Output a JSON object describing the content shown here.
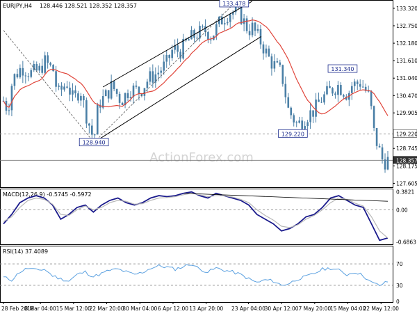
{
  "header": {
    "symbol": "EURJPY,H4",
    "ohlc": "128.446 128.521 128.352 128.357",
    "macd_title": "MACD(12,26,9) -0.5745 -0.5972",
    "rsi_title": "RSI(14) 37.4089"
  },
  "watermark": "ActionForex.com",
  "colors": {
    "candle": "#4a7fa6",
    "sma": "#e0453a",
    "macd_line": "#1a1a8c",
    "macd_signal": "#b8b8b8",
    "rsi": "#5aa0e0",
    "trendline": "#000000",
    "watermark": "#d4d4d4",
    "grid_dash": "#999999"
  },
  "chart_data": [
    {
      "type": "candlestick",
      "panel": "price",
      "ylim": [
        127.5,
        133.5
      ],
      "y_ticks": [
        "133.320",
        "132.750",
        "132.180",
        "131.610",
        "131.040",
        "130.470",
        "129.905",
        "129.220",
        "128.745",
        "128.357",
        "128.175",
        "127.605"
      ],
      "x_ticks": [
        "28 Feb 2018",
        "8 Mar 04:00",
        "15 Mar 12:00",
        "22 Mar 20:00",
        "30 Mar 04:00",
        "6 Apr 12:00",
        "13 Apr 20:00",
        "23 Apr 04:00",
        "30 Apr 12:00",
        "7 May 20:00",
        "15 May 04:00",
        "22 May 12:00"
      ],
      "labels": [
        {
          "text": "133.478",
          "x": "20 Apr",
          "y": 133.478
        },
        {
          "text": "128.940",
          "x": "20 Mar",
          "y": 128.94
        },
        {
          "text": "131.340",
          "x": "14 May",
          "y": 131.34
        },
        {
          "text": "129.220",
          "x": "3 May",
          "y": 129.22
        }
      ],
      "last_price": "128.357",
      "ref_level": "129.220",
      "overlay": "SMA",
      "close_path": [
        {
          "x": "28 Feb 2018",
          "y": 130.3
        },
        {
          "x": "1 Mar",
          "y": 130.0
        },
        {
          "x": "2 Mar",
          "y": 131.0
        },
        {
          "x": "4 Mar",
          "y": 131.4
        },
        {
          "x": "6 Mar",
          "y": 131.2
        },
        {
          "x": "8 Mar 04:00",
          "y": 131.3
        },
        {
          "x": "9 Mar",
          "y": 131.6
        },
        {
          "x": "11 Mar",
          "y": 131.3
        },
        {
          "x": "12 Mar",
          "y": 130.5
        },
        {
          "x": "14 Mar",
          "y": 130.9
        },
        {
          "x": "15 Mar 12:00",
          "y": 130.3
        },
        {
          "x": "17 Mar",
          "y": 130.7
        },
        {
          "x": "18 Mar",
          "y": 130.0
        },
        {
          "x": "20 Mar",
          "y": 129.0
        },
        {
          "x": "21 Mar",
          "y": 130.2
        },
        {
          "x": "22 Mar 20:00",
          "y": 130.5
        },
        {
          "x": "24 Mar",
          "y": 130.8
        },
        {
          "x": "26 Mar",
          "y": 130.3
        },
        {
          "x": "28 Mar",
          "y": 130.7
        },
        {
          "x": "30 Mar 04:00",
          "y": 130.6
        },
        {
          "x": "1 Apr",
          "y": 131.0
        },
        {
          "x": "3 Apr",
          "y": 131.2
        },
        {
          "x": "5 Apr",
          "y": 131.5
        },
        {
          "x": "6 Apr 12:00",
          "y": 132.0
        },
        {
          "x": "8 Apr",
          "y": 131.9
        },
        {
          "x": "10 Apr",
          "y": 132.3
        },
        {
          "x": "12 Apr",
          "y": 132.5
        },
        {
          "x": "13 Apr 20:00",
          "y": 132.6
        },
        {
          "x": "15 Apr",
          "y": 132.4
        },
        {
          "x": "17 Apr",
          "y": 132.9
        },
        {
          "x": "19 Apr",
          "y": 133.2
        },
        {
          "x": "21 Apr",
          "y": 133.2
        },
        {
          "x": "23 Apr 04:00",
          "y": 132.6
        },
        {
          "x": "24 Apr",
          "y": 132.7
        },
        {
          "x": "26 Apr",
          "y": 132.2
        },
        {
          "x": "28 Apr",
          "y": 131.6
        },
        {
          "x": "30 Apr 12:00",
          "y": 131.2
        },
        {
          "x": "2 May",
          "y": 130.0
        },
        {
          "x": "4 May",
          "y": 129.5
        },
        {
          "x": "6 May",
          "y": 129.8
        },
        {
          "x": "7 May 20:00",
          "y": 130.0
        },
        {
          "x": "9 May",
          "y": 130.3
        },
        {
          "x": "11 May",
          "y": 130.6
        },
        {
          "x": "13 May",
          "y": 130.8
        },
        {
          "x": "15 May 04:00",
          "y": 130.5
        },
        {
          "x": "16 May",
          "y": 130.8
        },
        {
          "x": "18 May",
          "y": 130.9
        },
        {
          "x": "20 May",
          "y": 130.4
        },
        {
          "x": "21 May",
          "y": 129.2
        },
        {
          "x": "22 May 12:00",
          "y": 128.5
        },
        {
          "x": "23 May",
          "y": 128.3
        },
        {
          "x": "24 May",
          "y": 128.357
        }
      ]
    },
    {
      "type": "line",
      "panel": "macd",
      "ylim": [
        -0.72,
        0.42
      ],
      "y_ticks": [
        "0.3821",
        "0.00",
        "-0.6863"
      ],
      "zero_line": true,
      "series": [
        {
          "name": "MACD",
          "values": [
            -0.3,
            -0.1,
            0.15,
            0.25,
            0.3,
            0.25,
            0.1,
            -0.2,
            -0.1,
            0.05,
            0.1,
            -0.05,
            0.1,
            0.2,
            0.25,
            0.15,
            0.1,
            0.15,
            0.25,
            0.3,
            0.28,
            0.3,
            0.35,
            0.38,
            0.3,
            0.25,
            0.35,
            0.3,
            0.25,
            0.2,
            0.1,
            -0.1,
            -0.2,
            -0.3,
            -0.45,
            -0.4,
            -0.3,
            -0.15,
            -0.1,
            0.05,
            0.25,
            0.3,
            0.2,
            0.1,
            0.05,
            -0.3,
            -0.65,
            -0.6
          ]
        },
        {
          "name": "Signal",
          "values": [
            -0.25,
            -0.15,
            0.05,
            0.2,
            0.25,
            0.22,
            0.12,
            -0.1,
            -0.12,
            0.0,
            0.08,
            0.0,
            0.05,
            0.15,
            0.2,
            0.18,
            0.12,
            0.13,
            0.2,
            0.25,
            0.26,
            0.28,
            0.32,
            0.35,
            0.32,
            0.28,
            0.3,
            0.3,
            0.27,
            0.22,
            0.15,
            0.0,
            -0.12,
            -0.22,
            -0.35,
            -0.38,
            -0.32,
            -0.2,
            -0.12,
            0.0,
            0.15,
            0.25,
            0.22,
            0.14,
            0.08,
            -0.15,
            -0.45,
            -0.6
          ]
        }
      ]
    },
    {
      "type": "line",
      "panel": "rsi",
      "ylim": [
        0,
        100
      ],
      "y_ticks": [
        "70",
        "30",
        "0"
      ],
      "levels": [
        70,
        30
      ],
      "series": [
        {
          "name": "RSI",
          "values": [
            45,
            40,
            55,
            62,
            58,
            60,
            48,
            42,
            38,
            50,
            55,
            46,
            52,
            58,
            60,
            55,
            50,
            54,
            62,
            66,
            64,
            60,
            65,
            70,
            60,
            55,
            62,
            58,
            55,
            50,
            42,
            35,
            40,
            38,
            30,
            34,
            42,
            46,
            52,
            60,
            62,
            58,
            50,
            55,
            48,
            35,
            30,
            37
          ]
        }
      ]
    }
  ]
}
